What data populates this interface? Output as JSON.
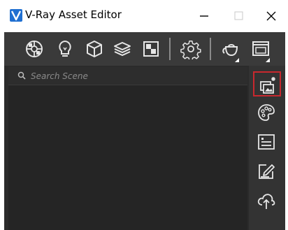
{
  "window": {
    "title": "V-Ray Asset Editor",
    "controls": [
      "minimize",
      "maximize",
      "close"
    ]
  },
  "toolbar": {
    "icons": [
      "materials-icon",
      "lights-icon",
      "geometry-icon",
      "render-elements-icon",
      "textures-icon",
      "settings-icon",
      "render-teapot-icon",
      "frame-buffer-icon"
    ]
  },
  "search": {
    "placeholder": "Search Scene",
    "value": ""
  },
  "sidebar": {
    "buttons": [
      {
        "name": "add-asset-icon",
        "active": true
      },
      {
        "name": "palette-icon",
        "active": false
      },
      {
        "name": "list-icon",
        "active": false
      },
      {
        "name": "edit-icon",
        "active": false
      },
      {
        "name": "upload-icon",
        "active": false
      }
    ]
  },
  "colors": {
    "accent_active_border": "#c8282e",
    "logo_blue": "#1f6fd1"
  }
}
